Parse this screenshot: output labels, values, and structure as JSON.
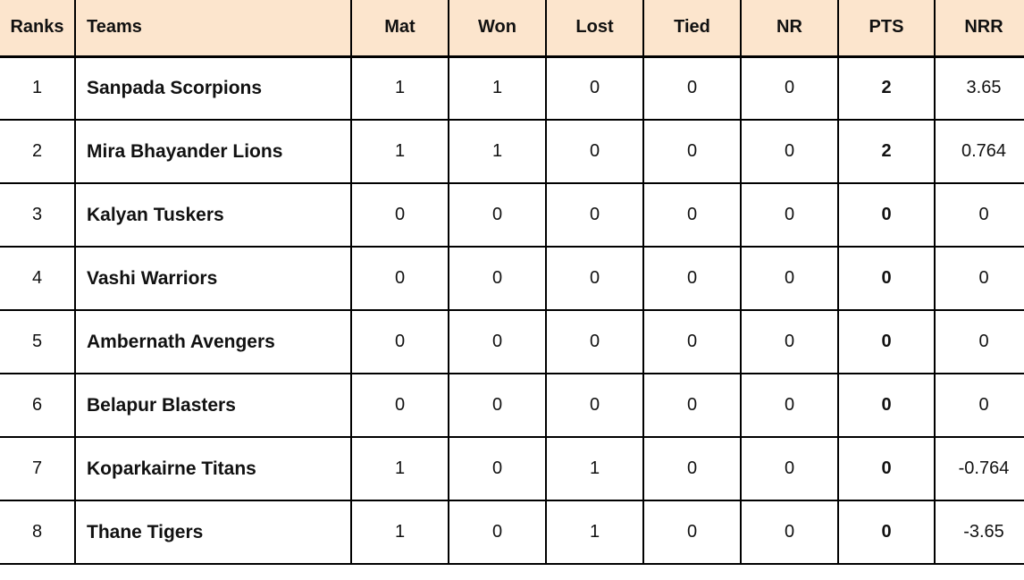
{
  "table": {
    "name": "points-table",
    "colors": {
      "header_background": "#fce5cd",
      "border": "#000000",
      "body_background": "#ffffff",
      "text": "#111111"
    },
    "headers": {
      "ranks": "Ranks",
      "teams": "Teams",
      "mat": "Mat",
      "won": "Won",
      "lost": "Lost",
      "tied": "Tied",
      "nr": "NR",
      "pts": "PTS",
      "nrr": "NRR"
    },
    "rows": [
      {
        "rank": "1",
        "team": "Sanpada Scorpions",
        "mat": "1",
        "won": "1",
        "lost": "0",
        "tied": "0",
        "nr": "0",
        "pts": "2",
        "nrr": "3.65"
      },
      {
        "rank": "2",
        "team": "Mira Bhayander Lions",
        "mat": "1",
        "won": "1",
        "lost": "0",
        "tied": "0",
        "nr": "0",
        "pts": "2",
        "nrr": "0.764"
      },
      {
        "rank": "3",
        "team": "Kalyan Tuskers",
        "mat": "0",
        "won": "0",
        "lost": "0",
        "tied": "0",
        "nr": "0",
        "pts": "0",
        "nrr": "0"
      },
      {
        "rank": "4",
        "team": "Vashi Warriors",
        "mat": "0",
        "won": "0",
        "lost": "0",
        "tied": "0",
        "nr": "0",
        "pts": "0",
        "nrr": "0"
      },
      {
        "rank": "5",
        "team": "Ambernath Avengers",
        "mat": "0",
        "won": "0",
        "lost": "0",
        "tied": "0",
        "nr": "0",
        "pts": "0",
        "nrr": "0"
      },
      {
        "rank": "6",
        "team": "Belapur Blasters",
        "mat": "0",
        "won": "0",
        "lost": "0",
        "tied": "0",
        "nr": "0",
        "pts": "0",
        "nrr": "0"
      },
      {
        "rank": "7",
        "team": "Koparkairne Titans",
        "mat": "1",
        "won": "0",
        "lost": "1",
        "tied": "0",
        "nr": "0",
        "pts": "0",
        "nrr": "-0.764"
      },
      {
        "rank": "8",
        "team": "Thane Tigers",
        "mat": "1",
        "won": "0",
        "lost": "1",
        "tied": "0",
        "nr": "0",
        "pts": "0",
        "nrr": "-3.65"
      }
    ]
  }
}
